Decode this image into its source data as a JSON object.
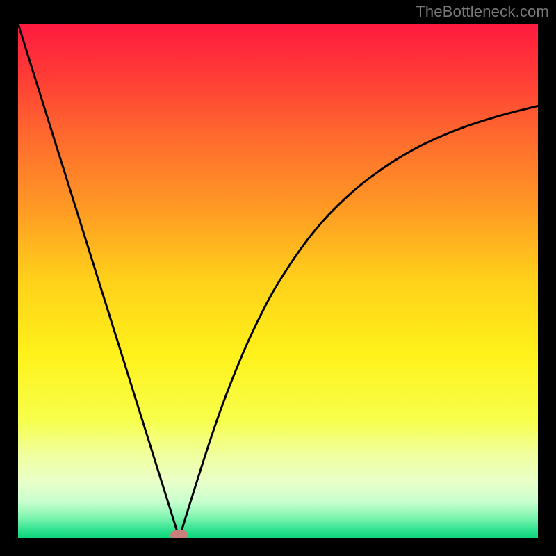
{
  "watermark": "TheBottleneck.com",
  "chart_data": {
    "type": "line",
    "x_range": [
      0,
      100
    ],
    "y_range": [
      0,
      100
    ],
    "xlabel": "",
    "ylabel": "",
    "title": "",
    "grid": false,
    "legend": false,
    "series": [
      {
        "name": "curve",
        "x": [
          0,
          2,
          4,
          6,
          8,
          10,
          12,
          14,
          16,
          18,
          20,
          22,
          24,
          26,
          28,
          30,
          31,
          32,
          33,
          34,
          36,
          38,
          40,
          42,
          44,
          46,
          48,
          50,
          54,
          58,
          62,
          66,
          70,
          74,
          78,
          82,
          86,
          90,
          94,
          98,
          100
        ],
        "y": [
          100,
          93.5,
          87.1,
          80.6,
          74.2,
          67.7,
          61.3,
          54.8,
          48.4,
          41.9,
          35.5,
          29.0,
          22.6,
          16.1,
          9.7,
          3.2,
          0.0,
          3.2,
          6.5,
          9.7,
          16.1,
          22.2,
          27.8,
          32.9,
          37.7,
          42.0,
          46.0,
          49.6,
          55.8,
          61.0,
          65.2,
          68.8,
          71.8,
          74.4,
          76.6,
          78.4,
          80.0,
          81.3,
          82.5,
          83.5,
          84.0
        ]
      }
    ],
    "marker": {
      "x": 31,
      "y": 0.6,
      "color": "#c97f7a"
    },
    "gradient_stops": [
      {
        "offset": 0.0,
        "color": "#ff1a40"
      },
      {
        "offset": 0.1,
        "color": "#ff3b36"
      },
      {
        "offset": 0.22,
        "color": "#ff6a2e"
      },
      {
        "offset": 0.36,
        "color": "#ff9a24"
      },
      {
        "offset": 0.5,
        "color": "#ffd11a"
      },
      {
        "offset": 0.64,
        "color": "#fff11a"
      },
      {
        "offset": 0.77,
        "color": "#f7ff4a"
      },
      {
        "offset": 0.84,
        "color": "#f0ffa0"
      },
      {
        "offset": 0.89,
        "color": "#e9ffc8"
      },
      {
        "offset": 0.93,
        "color": "#c8ffcf"
      },
      {
        "offset": 0.96,
        "color": "#80f5b0"
      },
      {
        "offset": 0.985,
        "color": "#2ee18f"
      },
      {
        "offset": 1.0,
        "color": "#0cd77a"
      }
    ],
    "curve_color": "#000000",
    "curve_width": 3
  }
}
